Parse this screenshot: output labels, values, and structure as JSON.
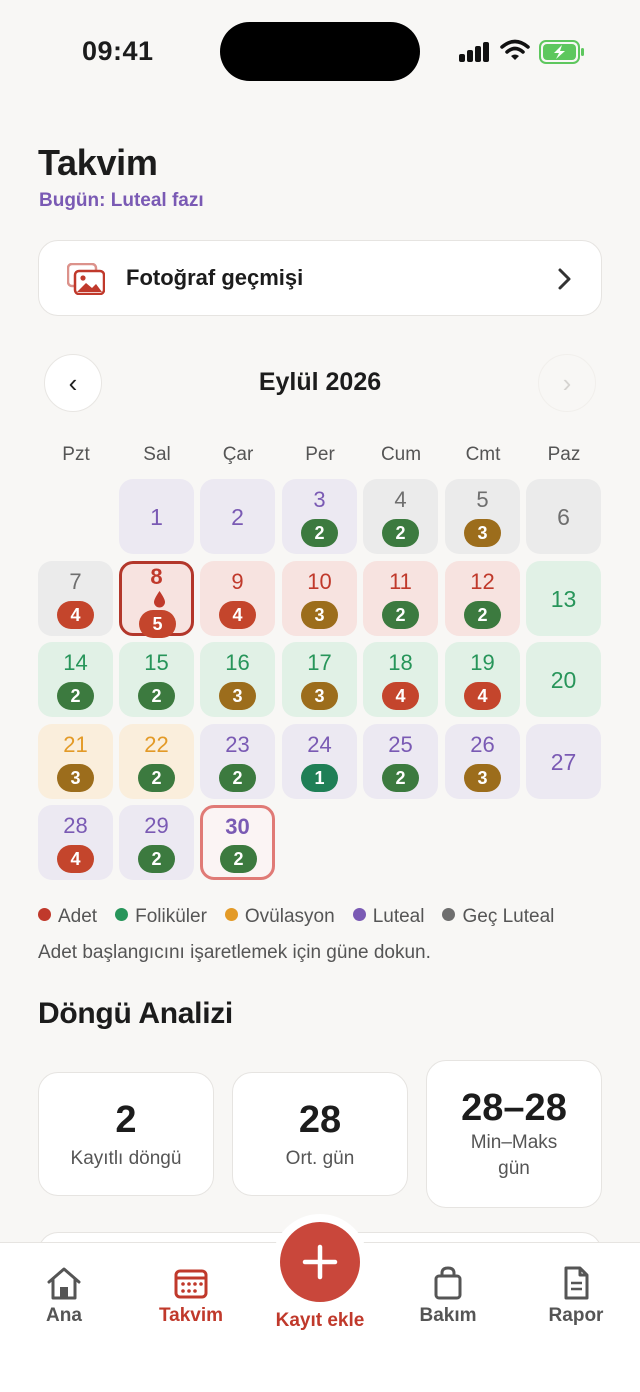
{
  "status_bar": {
    "time": "09:41"
  },
  "header": {
    "title": "Takvim",
    "subtitle": "Bugün: Luteal fazı"
  },
  "photo_history": {
    "label": "Fotoğraf geçmişi",
    "icon": "photo-gallery-icon"
  },
  "calendar": {
    "month_label": "Eylül 2026",
    "prev_label": "‹",
    "next_label": "›",
    "weekdays": [
      "Pzt",
      "Sal",
      "Çar",
      "Per",
      "Cum",
      "Cmt",
      "Paz"
    ],
    "phase_colors": {
      "adet": "#c0392b",
      "folikuler": "#27955a",
      "ovulasyon": "#e39a27",
      "luteal": "#7a5ab4",
      "gec_luteal": "#6e6e6e"
    },
    "days": [
      {
        "day": "1",
        "phase": "luteal"
      },
      {
        "day": "2",
        "phase": "luteal"
      },
      {
        "day": "3",
        "phase": "luteal",
        "badge": "2"
      },
      {
        "day": "4",
        "phase": "gec_luteal",
        "badge": "2"
      },
      {
        "day": "5",
        "phase": "gec_luteal",
        "badge": "3"
      },
      {
        "day": "6",
        "phase": "gec_luteal"
      },
      {
        "day": "7",
        "phase": "gec_luteal",
        "badge": "4"
      },
      {
        "day": "8",
        "phase": "adet",
        "badge": "5",
        "period_start": true
      },
      {
        "day": "9",
        "phase": "adet",
        "badge": "4"
      },
      {
        "day": "10",
        "phase": "adet",
        "badge": "3"
      },
      {
        "day": "11",
        "phase": "adet",
        "badge": "2"
      },
      {
        "day": "12",
        "phase": "adet",
        "badge": "2"
      },
      {
        "day": "13",
        "phase": "folikuler"
      },
      {
        "day": "14",
        "phase": "folikuler",
        "badge": "2"
      },
      {
        "day": "15",
        "phase": "folikuler",
        "badge": "2"
      },
      {
        "day": "16",
        "phase": "folikuler",
        "badge": "3"
      },
      {
        "day": "17",
        "phase": "folikuler",
        "badge": "3"
      },
      {
        "day": "18",
        "phase": "folikuler",
        "badge": "4"
      },
      {
        "day": "19",
        "phase": "folikuler",
        "badge": "4"
      },
      {
        "day": "20",
        "phase": "folikuler"
      },
      {
        "day": "21",
        "phase": "ovulasyon",
        "badge": "3"
      },
      {
        "day": "22",
        "phase": "ovulasyon",
        "badge": "2"
      },
      {
        "day": "23",
        "phase": "luteal",
        "badge": "2"
      },
      {
        "day": "24",
        "phase": "luteal",
        "badge": "1"
      },
      {
        "day": "25",
        "phase": "luteal",
        "badge": "2"
      },
      {
        "day": "26",
        "phase": "luteal",
        "badge": "3"
      },
      {
        "day": "27",
        "phase": "luteal"
      },
      {
        "day": "28",
        "phase": "luteal",
        "badge": "4"
      },
      {
        "day": "29",
        "phase": "luteal",
        "badge": "2"
      },
      {
        "day": "30",
        "phase": "luteal",
        "badge": "2",
        "today": true
      }
    ]
  },
  "legend": [
    {
      "label": "Adet",
      "color": "#c0392b"
    },
    {
      "label": "Foliküler",
      "color": "#27955a"
    },
    {
      "label": "Ovülasyon",
      "color": "#e39a27"
    },
    {
      "label": "Luteal",
      "color": "#7a5ab4"
    },
    {
      "label": "Geç Luteal",
      "color": "#6e6e6e"
    }
  ],
  "hint": "Adet başlangıcını işaretlemek için güne dokun.",
  "cycle_analysis": {
    "title": "Döngü Analizi",
    "stats": [
      {
        "value": "2",
        "label": "Kayıtlı döngü"
      },
      {
        "value": "28",
        "label": "Ort. gün"
      },
      {
        "value": "28–28",
        "label": "Min–Maks gün"
      }
    ]
  },
  "bottom_nav": {
    "tabs": [
      {
        "label": "Ana",
        "icon": "home-icon"
      },
      {
        "label": "Takvim",
        "icon": "calendar-icon",
        "active": true
      },
      {
        "label": "Bakım",
        "icon": "shopping-bag-icon"
      },
      {
        "label": "Rapor",
        "icon": "document-icon"
      }
    ],
    "fab_label": "Kayıt ekle",
    "fab_icon": "plus-icon"
  }
}
